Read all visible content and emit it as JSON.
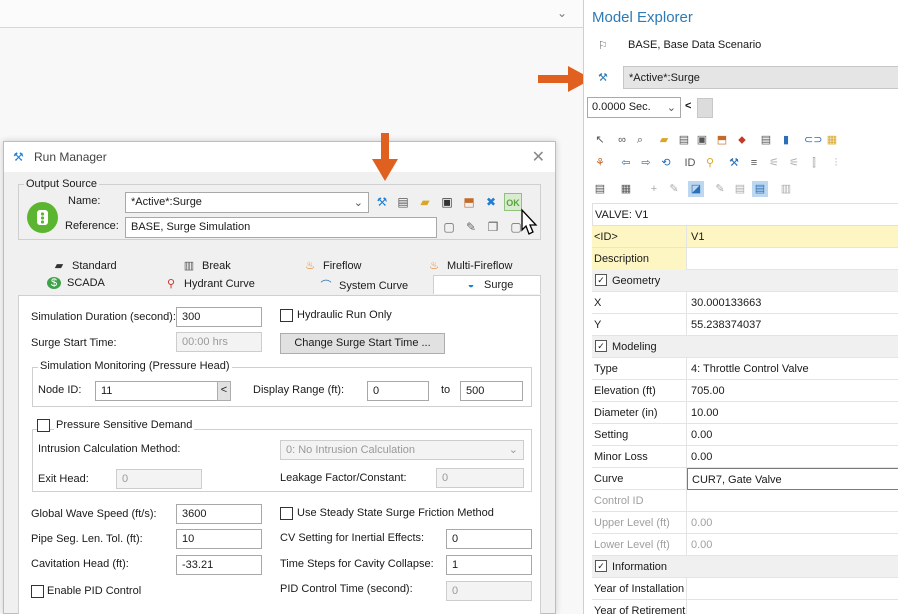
{
  "run_manager": {
    "title": "Run Manager",
    "output_source": {
      "group_label": "Output Source",
      "name_label": "Name:",
      "name_value": "*Active*:Surge",
      "reference_label": "Reference:",
      "reference_value": "BASE, Surge Simulation"
    },
    "tabs_row1": [
      "Standard",
      "Break",
      "Fireflow",
      "Multi-Fireflow"
    ],
    "tabs_row2": [
      "SCADA",
      "Hydrant Curve",
      "System Curve",
      "Surge"
    ],
    "surge": {
      "sim_duration_label": "Simulation Duration (second):",
      "sim_duration_value": "300",
      "hydraulic_only_label": "Hydraulic Run Only",
      "surge_start_label": "Surge Start Time:",
      "surge_start_value": "00:00 hrs",
      "change_start_button": "Change Surge Start Time ...",
      "monitoring_label": "Simulation Monitoring (Pressure Head)",
      "node_id_label": "Node ID:",
      "node_id_value": "11",
      "node_id_btn": "<",
      "display_range_label": "Display Range (ft):",
      "range_from": "0",
      "range_to_label": "to",
      "range_to": "500",
      "psd_label": "Pressure Sensitive Demand",
      "intrusion_label": "Intrusion Calculation Method:",
      "intrusion_value": "0: No Intrusion Calculation",
      "exit_head_label": "Exit Head:",
      "exit_head_value": "0",
      "leakage_label": "Leakage Factor/Constant:",
      "leakage_value": "0",
      "wave_speed_label": "Global Wave Speed (ft/s):",
      "wave_speed_value": "3600",
      "steady_friction_label": "Use Steady State Surge Friction Method",
      "pipe_seg_label": "Pipe Seg. Len. Tol. (ft):",
      "pipe_seg_value": "10",
      "cv_setting_label": "CV Setting for Inertial Effects:",
      "cv_setting_value": "0",
      "cavitation_label": "Cavitation Head (ft):",
      "cavitation_value": "-33.21",
      "time_steps_label": "Time Steps for Cavity Collapse:",
      "time_steps_value": "1",
      "pid_label": "Enable PID Control",
      "pid_time_label": "PID Control Time (second):",
      "pid_time_value": "0"
    },
    "close_glyph": "✕"
  },
  "model_explorer": {
    "title": "Model Explorer",
    "scenarios": [
      {
        "label": "BASE, Base Data Scenario"
      },
      {
        "label": "*Active*:Surge"
      }
    ],
    "time_value": "0.0000 Sec.",
    "time_nav": "<",
    "element_header": "VALVE: V1",
    "properties": [
      {
        "key": "<ID>",
        "value": "V1",
        "type": "yellow"
      },
      {
        "key": "Description",
        "value": "",
        "type": "yellow"
      },
      {
        "key": "Geometry",
        "type": "cat"
      },
      {
        "key": "X",
        "value": "30.000133663"
      },
      {
        "key": "Y",
        "value": "55.238374037"
      },
      {
        "key": "Modeling",
        "type": "cat"
      },
      {
        "key": "Type",
        "value": "4: Throttle Control Valve"
      },
      {
        "key": "Elevation (ft)",
        "value": "705.00"
      },
      {
        "key": "Diameter (in)",
        "value": "10.00"
      },
      {
        "key": "Setting",
        "value": "0.00"
      },
      {
        "key": "Minor Loss",
        "value": "0.00"
      },
      {
        "key": "Curve",
        "value": "CUR7, Gate Valve",
        "type": "boxed"
      },
      {
        "key": "Control ID",
        "value": "",
        "type": "disabled"
      },
      {
        "key": "Upper Level (ft)",
        "value": "0.00",
        "type": "disabled"
      },
      {
        "key": "Lower Level (ft)",
        "value": "0.00",
        "type": "disabled"
      },
      {
        "key": "Information",
        "type": "cat"
      },
      {
        "key": "Year of Installation",
        "value": ""
      },
      {
        "key": "Year of Retirement",
        "value": ""
      }
    ]
  },
  "colors": {
    "accent": "#2d7ab5",
    "arrow": "#e0601f",
    "yellow": "#fdf6c2"
  }
}
